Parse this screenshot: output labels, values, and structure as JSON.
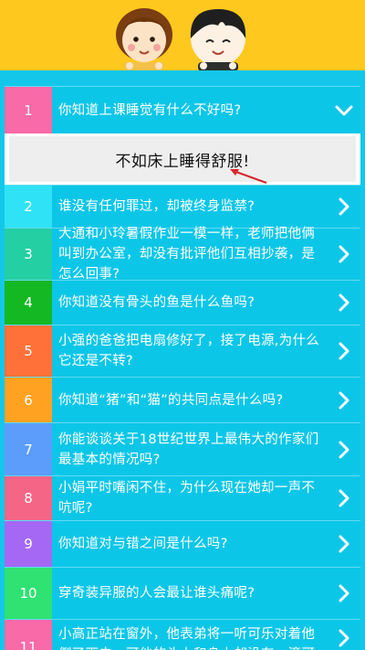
{
  "colors": {
    "header_bg": "#ffc81f",
    "list_bg": "#14c7ea",
    "answer_bg": "#eeeeee",
    "pointer": "#d9262b"
  },
  "answer": {
    "text": "不如床上睡得舒服!"
  },
  "items": [
    {
      "num": "1",
      "question": "你知道上课睡觉有什么不好吗?",
      "color": "#f86aa8",
      "arrow": "chevron-down-icon"
    },
    {
      "num": "2",
      "question": "谁没有任何罪过，却被终身监禁?",
      "color": "#30e2f5",
      "arrow": "chevron-right-icon"
    },
    {
      "num": "3",
      "question": "大通和小玲暑假作业一模一样，老师把他俩叫到办公室，却没有批评他们互相抄袭，是怎么回事?",
      "color": "#23cfa3",
      "arrow": "chevron-right-icon"
    },
    {
      "num": "4",
      "question": "你知道没有骨头的鱼是什么鱼吗?",
      "color": "#14b823",
      "arrow": "chevron-right-icon"
    },
    {
      "num": "5",
      "question": "小强的爸爸把电扇修好了，接了电源,为什么它还是不转?",
      "color": "#ff7139",
      "arrow": "chevron-right-icon"
    },
    {
      "num": "6",
      "question": "你知道“猪”和“猫”的共同点是什么吗?",
      "color": "#ffa221",
      "arrow": "chevron-right-icon"
    },
    {
      "num": "7",
      "question": "你能谈谈关于18世纪世界上最伟大的作家们最基本的情况吗?",
      "color": "#5c9dfb",
      "arrow": "chevron-right-icon"
    },
    {
      "num": "8",
      "question": "小娟平时嘴闲不住，为什么现在她却一声不吭呢?",
      "color": "#f56586",
      "arrow": "chevron-right-icon"
    },
    {
      "num": "9",
      "question": "你知道对与错之间是什么吗?",
      "color": "#a468f5",
      "arrow": "chevron-right-icon"
    },
    {
      "num": "10",
      "question": "穿奇装异服的人会最让谁头痛呢?",
      "color": "#30e272",
      "arrow": "chevron-right-icon"
    },
    {
      "num": "11",
      "question": "小高正站在窗外，他表弟将一听可乐对着他倒了下去，可他的头上和身上却没有一滴可乐汁，她而也没",
      "color": "#f86aa8",
      "arrow": "chevron-right-icon"
    }
  ]
}
